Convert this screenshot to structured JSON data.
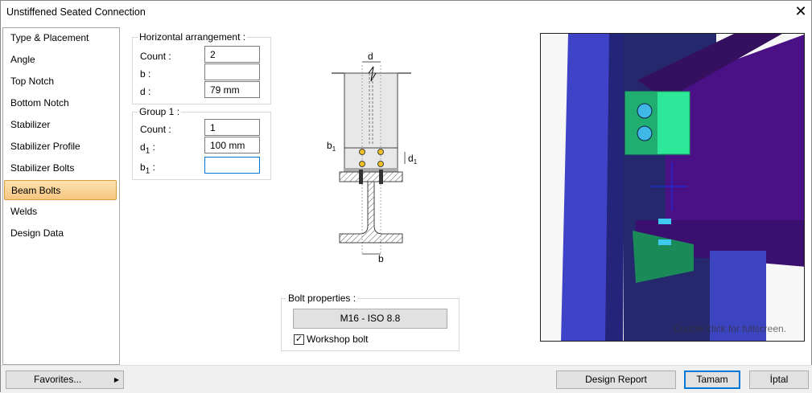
{
  "window": {
    "title": "Unstiffened Seated Connection",
    "close_icon": "close-icon"
  },
  "sidebar": {
    "items": [
      {
        "label": "Type & Placement"
      },
      {
        "label": "Angle"
      },
      {
        "label": "Top Notch"
      },
      {
        "label": "Bottom Notch"
      },
      {
        "label": "Stabilizer"
      },
      {
        "label": "Stabilizer Profile"
      },
      {
        "label": "Stabilizer Bolts"
      },
      {
        "label": "Beam Bolts",
        "selected": true
      },
      {
        "label": "Welds"
      },
      {
        "label": "Design Data"
      }
    ]
  },
  "horizontal": {
    "title": "Horizontal arrangement :",
    "count_label": "Count :",
    "count": "2",
    "b_label": "b :",
    "b": "",
    "d_label": "d :",
    "d": "79 mm"
  },
  "group1": {
    "title": "Group 1 :",
    "count_label": "Count :",
    "count": "1",
    "d1_label": "d",
    "d1_sub": "1",
    "d1": "100 mm",
    "b1_label": "b",
    "b1_sub": "1",
    "b1": ""
  },
  "diagram": {
    "d": "d",
    "b1": "b",
    "b1_sub": "1",
    "d1": "d",
    "d1_sub": "1",
    "b": "b"
  },
  "bolt": {
    "title": "Bolt properties :",
    "button": "M16 - ISO 8.8",
    "workshop_label": "Workshop bolt",
    "workshop_checked": true
  },
  "view": {
    "hint": "Double click for fullscreen."
  },
  "footer": {
    "favorites": "Favorites...",
    "design_report": "Design Report",
    "ok": "Tamam",
    "cancel": "İptal"
  },
  "colors": {
    "selected_bg": "#f7c680",
    "focus": "#0078d7",
    "column": "#3f3fc8",
    "beam": "#4a1187",
    "angle": "#2ee89a",
    "bolt": "#3fb8e8"
  }
}
